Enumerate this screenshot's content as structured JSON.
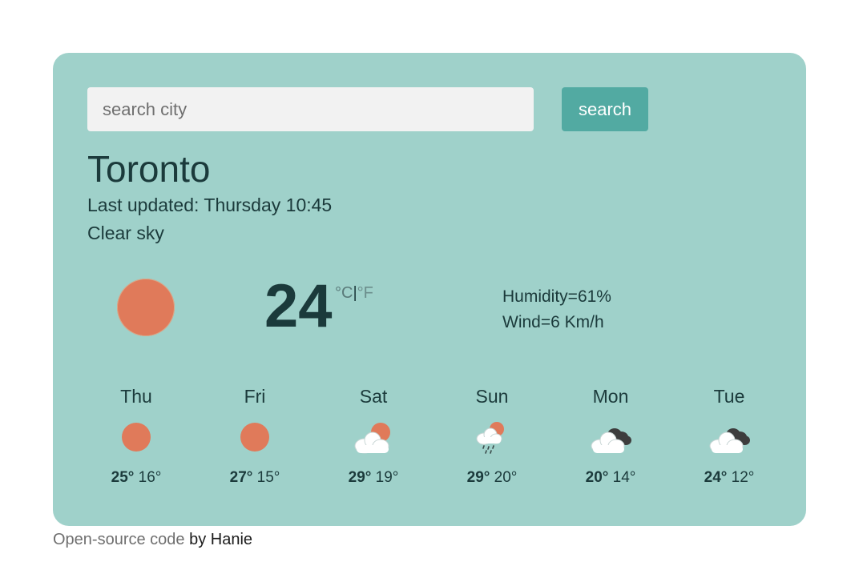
{
  "search": {
    "placeholder": "search city",
    "button_label": "search"
  },
  "current": {
    "city": "Toronto",
    "last_updated_label": "Last updated:",
    "last_updated_value": "Thursday 10:45",
    "description": "Clear sky",
    "icon": "sun-icon",
    "temperature": "24",
    "unit_c": "°C",
    "unit_separator": "|",
    "unit_f": "°F",
    "humidity": "Humidity=61%",
    "wind": "Wind=6 Km/h"
  },
  "forecast": [
    {
      "day": "Thu",
      "icon": "sun-icon",
      "max": "25°",
      "min": "16°"
    },
    {
      "day": "Fri",
      "icon": "sun-icon",
      "max": "27°",
      "min": "15°"
    },
    {
      "day": "Sat",
      "icon": "partly-cloudy-icon",
      "max": "29°",
      "min": "19°"
    },
    {
      "day": "Sun",
      "icon": "rain-cloud-sun-icon",
      "max": "29°",
      "min": "20°"
    },
    {
      "day": "Mon",
      "icon": "broken-clouds-icon",
      "max": "20°",
      "min": "14°"
    },
    {
      "day": "Tue",
      "icon": "broken-clouds-icon",
      "max": "24°",
      "min": "12°"
    }
  ],
  "footer": {
    "link_text": "Open-source code",
    "suffix": " by Hanie"
  },
  "colors": {
    "card_background": "#9fd1ca",
    "button_background": "#52aaa2",
    "sun": "#e07a5a",
    "text": "#1b3a3b"
  }
}
